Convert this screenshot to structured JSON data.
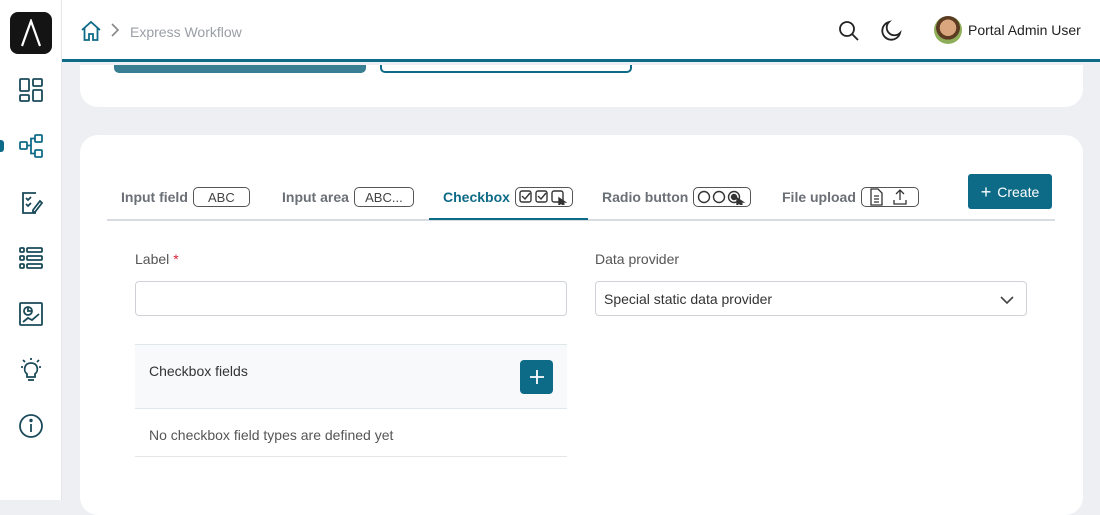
{
  "app": {
    "logo_icon": "lambda-logo-icon",
    "nav": [
      {
        "icon": "dashboard-icon"
      },
      {
        "icon": "workflow-icon",
        "active": true
      },
      {
        "icon": "task-checklist-icon"
      },
      {
        "icon": "list-icon"
      },
      {
        "icon": "report-chart-icon"
      },
      {
        "icon": "lightbulb-icon"
      },
      {
        "icon": "info-icon"
      }
    ]
  },
  "header": {
    "breadcrumb": "Express Workflow",
    "user_name": "Portal Admin User",
    "accent": "#0e6b88"
  },
  "tabs": [
    {
      "label": "Input field",
      "glyph": "ABC"
    },
    {
      "label": "Input area",
      "glyph": "ABC..."
    },
    {
      "label": "Checkbox",
      "glyph_icon": "checkbox-group-icon",
      "active": true
    },
    {
      "label": "Radio button",
      "glyph_icon": "radio-group-icon"
    },
    {
      "label": "File upload",
      "glyph_icon": "file-upload-icon"
    }
  ],
  "create_button": {
    "label": "Create"
  },
  "form": {
    "label_field": {
      "label": "Label",
      "required_mark": "*",
      "value": ""
    },
    "data_provider": {
      "label": "Data provider",
      "selected": "Special static data provider"
    },
    "checkbox_fields": {
      "title": "Checkbox fields",
      "empty_message": "No checkbox field types are defined yet"
    }
  }
}
